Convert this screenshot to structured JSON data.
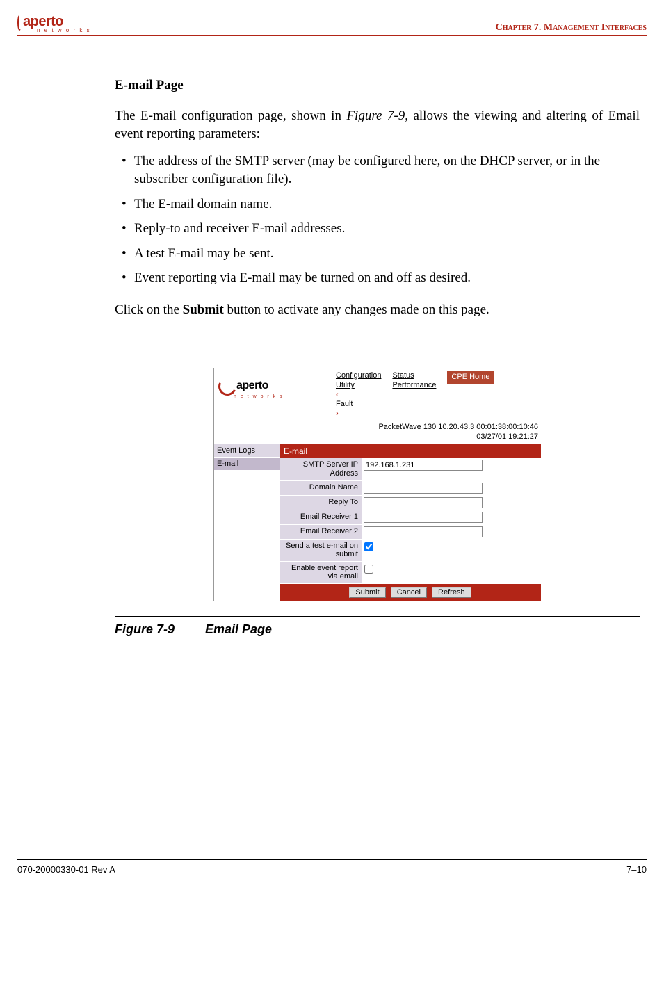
{
  "header": {
    "logo_text": "aperto",
    "logo_sub": "n e t w o r k s",
    "chapter": "Chapter 7.  Management Interfaces"
  },
  "section_title": "E-mail Page",
  "intro_1a": "The E-mail configuration page, shown in ",
  "intro_1b": "Figure 7-9",
  "intro_1c": ", allows the viewing and altering of Email event reporting parameters:",
  "bullets": [
    "The address of the SMTP server (may be configured here, on the DHCP server, or in the subscriber configuration file).",
    "The E-mail domain name.",
    "Reply-to and receiver E-mail addresses.",
    "A test E-mail may be sent.",
    "Event reporting via E-mail may be turned on and off as desired."
  ],
  "submit_1a": "Click on the ",
  "submit_1b": "Submit",
  "submit_1c": " button to activate any changes made on this page.",
  "screenshot": {
    "logo_text": "aperto",
    "logo_sub": "n e t w o r k s",
    "nav": {
      "col1_a": "Configuration",
      "col1_b": "Utility",
      "fault": "Fault",
      "col2_a": "Status",
      "col2_b": "Performance",
      "cpe_home": "CPE Home"
    },
    "status": {
      "line1": "PacketWave 130    10.20.43.3    00:01:38:00:10:46",
      "line2": "03/27/01    19:21:27"
    },
    "sidebar": {
      "event_logs": "Event Logs",
      "email": "E-mail"
    },
    "panel_title": "E-mail",
    "fields": {
      "smtp_label": "SMTP Server IP Address",
      "smtp_value": "192.168.1.231",
      "domain_label": "Domain Name",
      "domain_value": "",
      "replyto_label": "Reply To",
      "replyto_value": "",
      "recv1_label": "Email Receiver 1",
      "recv1_value": "",
      "recv2_label": "Email Receiver 2",
      "recv2_value": "",
      "test_label": "Send a test e-mail on submit",
      "enable_label": "Enable event report via email"
    },
    "buttons": {
      "submit": "Submit",
      "cancel": "Cancel",
      "refresh": "Refresh"
    }
  },
  "figure": {
    "num": "Figure 7-9",
    "title": "Email Page"
  },
  "footer": {
    "left": "070-20000330-01 Rev A",
    "right": "7–10"
  }
}
